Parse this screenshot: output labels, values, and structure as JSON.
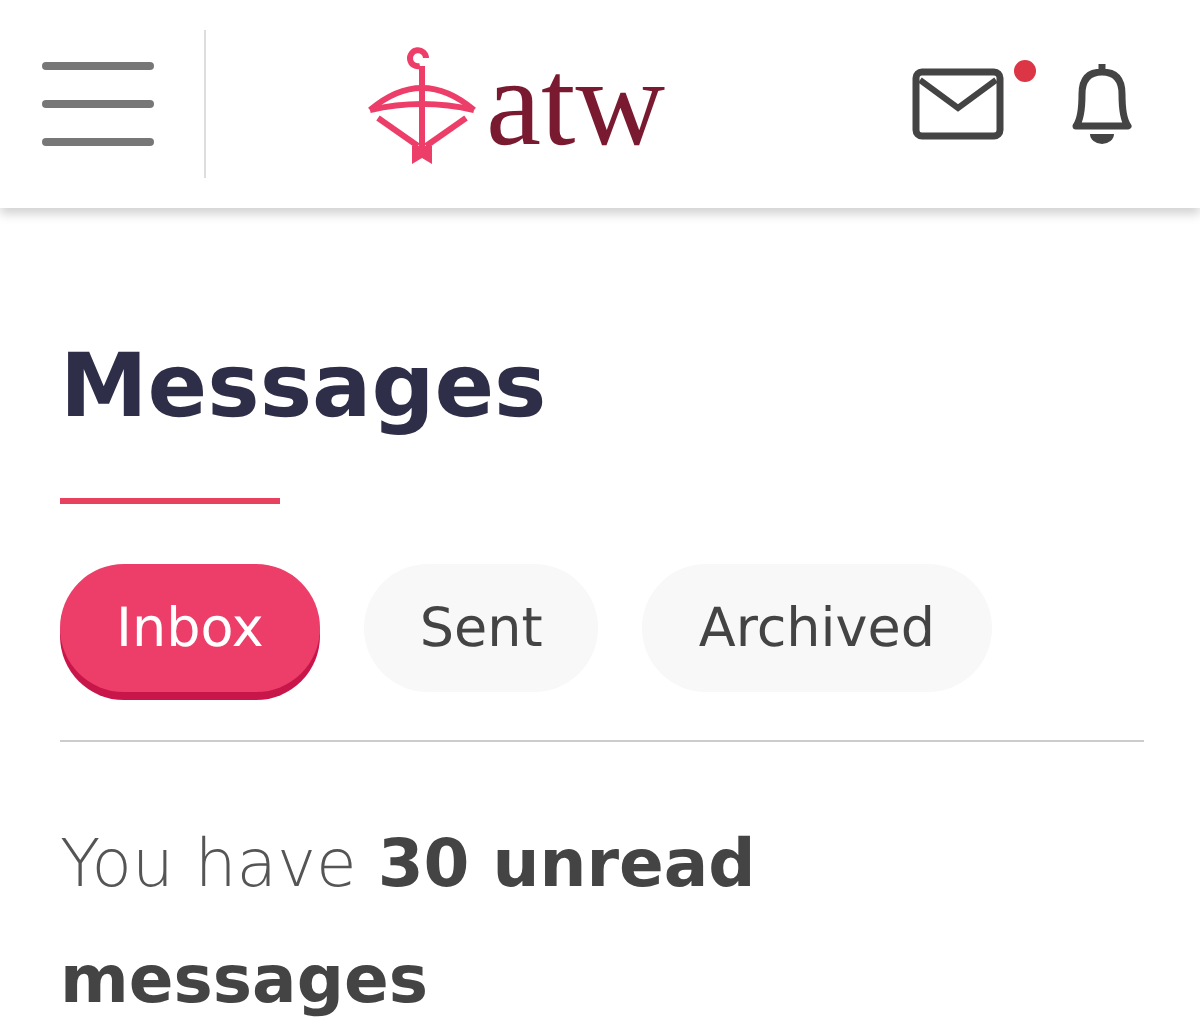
{
  "header": {
    "logo": "atw",
    "mail_unread": true
  },
  "title": "Messages",
  "tabs": [
    {
      "label": "Inbox",
      "selected": true
    },
    {
      "label": "Sent",
      "selected": false
    },
    {
      "label": "Archived",
      "selected": false
    }
  ],
  "summary": "You have **30 unread messages**"
}
